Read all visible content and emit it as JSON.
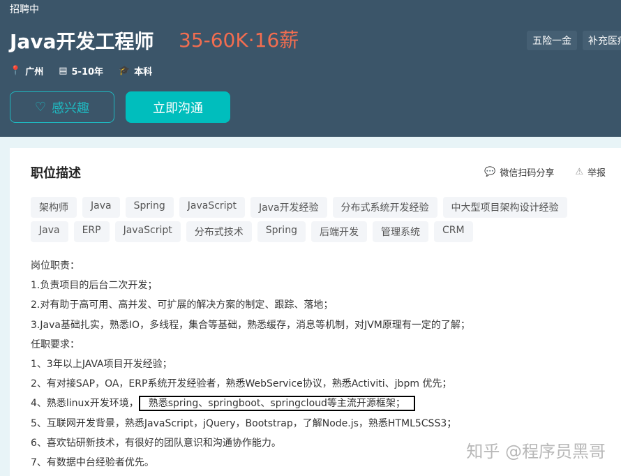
{
  "header": {
    "status": "招聘中",
    "title": "Java开发工程师",
    "salary": "35-60K·16薪",
    "welfare": [
      "五险一金",
      "补充医疗"
    ],
    "meta": {
      "city": "广州",
      "experience": "5-10年",
      "degree": "本科"
    },
    "like_button": "感兴趣",
    "chat_button": "立即沟通"
  },
  "card": {
    "title": "职位描述",
    "share": "微信扫码分享",
    "report": "举报",
    "tags_row1": [
      "架构师",
      "Java",
      "Spring",
      "JavaScript",
      "Java开发经验",
      "分布式系统开发经验",
      "中大型项目架构设计经验"
    ],
    "tags_row2": [
      "Java",
      "ERP",
      "JavaScript",
      "分布式技术",
      "Spring",
      "后端开发",
      "管理系统",
      "CRM"
    ],
    "lines": [
      "岗位职责：",
      "1.负责项目的后台二次开发；",
      "2.对有助于高可用、高并发、可扩展的解决方案的制定、跟踪、落地；",
      "3.Java基础扎实，熟悉IO，多线程，集合等基础，熟悉缓存，消息等机制，对JVM原理有一定的了解；",
      "任职要求：",
      "1、3年以上JAVA项目开发经验；",
      "2、有对接SAP，OA，ERP系统开发经验者，熟悉WebService协议，熟悉Activiti、jbpm 优先；"
    ],
    "line4_prefix": "4、熟悉linux开发环境，",
    "line4_boxed": "熟悉spring、springboot、springcloud等主流开源框架；",
    "lines_after": [
      "5、互联网开发背景，熟悉JavaScript，jQuery，Bootstrap，了解Node.js，熟悉HTML5CSS3；",
      "6、喜欢钻研新技术，有很好的团队意识和沟通协作能力。",
      "7、有数据中台经验者优先。"
    ]
  },
  "watermark": "知乎 @程序员黑哥"
}
